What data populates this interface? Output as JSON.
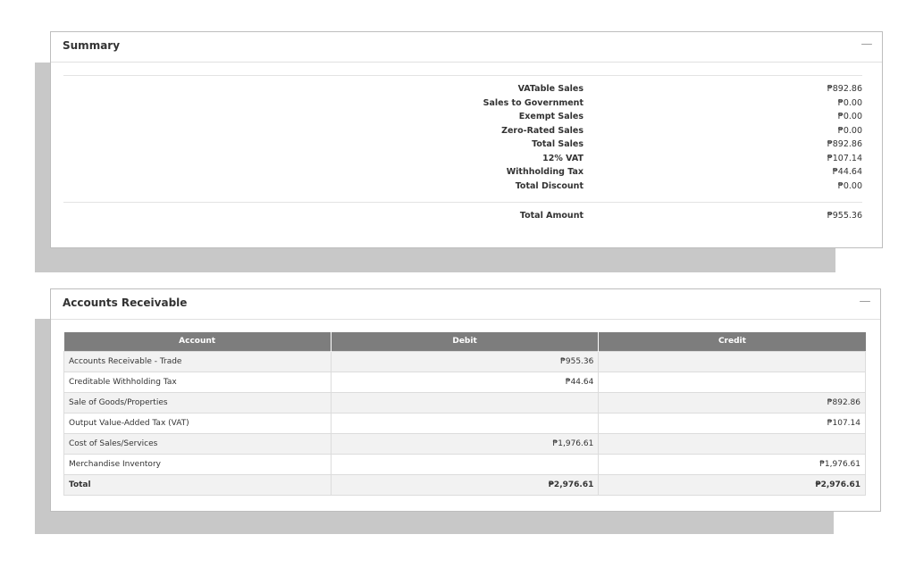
{
  "summary": {
    "title": "Summary",
    "collapse_glyph": "—",
    "rows": [
      {
        "label": "VATable Sales",
        "value": "₱892.86"
      },
      {
        "label": "Sales to Government",
        "value": "₱0.00"
      },
      {
        "label": "Exempt Sales",
        "value": "₱0.00"
      },
      {
        "label": "Zero-Rated Sales",
        "value": "₱0.00"
      },
      {
        "label": "Total Sales",
        "value": "₱892.86"
      },
      {
        "label": "12% VAT",
        "value": "₱107.14"
      },
      {
        "label": "Withholding Tax",
        "value": "₱44.64"
      },
      {
        "label": "Total Discount",
        "value": "₱0.00"
      }
    ],
    "total": {
      "label": "Total Amount",
      "value": "₱955.36"
    }
  },
  "accounts_receivable": {
    "title": "Accounts Receivable",
    "collapse_glyph": "—",
    "columns": [
      "Account",
      "Debit",
      "Credit"
    ],
    "rows": [
      {
        "account": "Accounts Receivable - Trade",
        "debit": "₱955.36",
        "credit": ""
      },
      {
        "account": "Creditable Withholding Tax",
        "debit": "₱44.64",
        "credit": ""
      },
      {
        "account": "Sale of Goods/Properties",
        "debit": "",
        "credit": "₱892.86"
      },
      {
        "account": "Output Value-Added Tax (VAT)",
        "debit": "",
        "credit": "₱107.14"
      },
      {
        "account": "Cost of Sales/Services",
        "debit": "₱1,976.61",
        "credit": ""
      },
      {
        "account": "Merchandise Inventory",
        "debit": "",
        "credit": "₱1,976.61"
      }
    ],
    "total": {
      "account": "Total",
      "debit": "₱2,976.61",
      "credit": "₱2,976.61"
    }
  }
}
